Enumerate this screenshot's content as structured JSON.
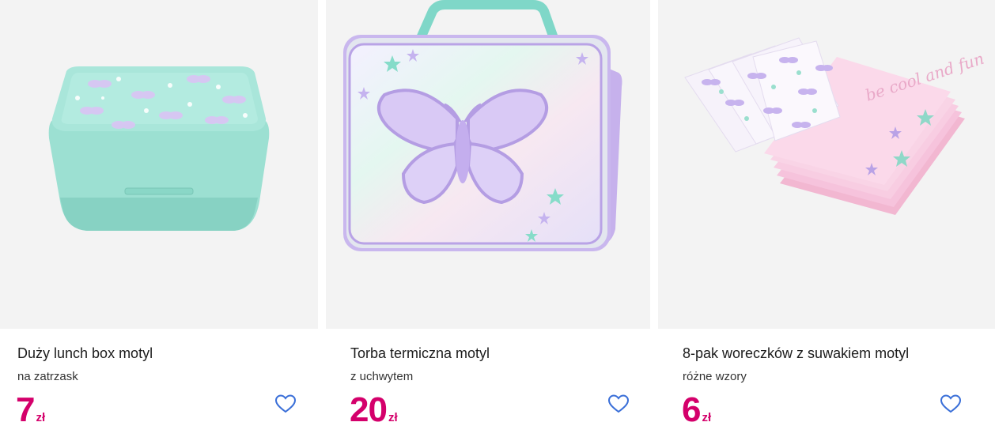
{
  "products": [
    {
      "title": "Duży lunch box motyl",
      "subtitle": "na zatrzask",
      "price": "7",
      "currency": "zł",
      "wishlist_icon": "heart-outline-icon"
    },
    {
      "title": "Torba termiczna motyl",
      "subtitle": "z uchwytem",
      "price": "20",
      "currency": "zł",
      "wishlist_icon": "heart-outline-icon"
    },
    {
      "title": "8-pak woreczków z suwakiem motyl",
      "subtitle": "różne wzory",
      "price": "6",
      "currency": "zł",
      "wishlist_icon": "heart-outline-icon",
      "image_text": "be cool and fun"
    }
  ],
  "colors": {
    "price": "#d4006b",
    "heart": "#3a6fd8",
    "image_bg": "#f3f3f3",
    "mint": "#9fe3d6",
    "lilac": "#c9b3ef",
    "pink": "#f6c8df"
  }
}
